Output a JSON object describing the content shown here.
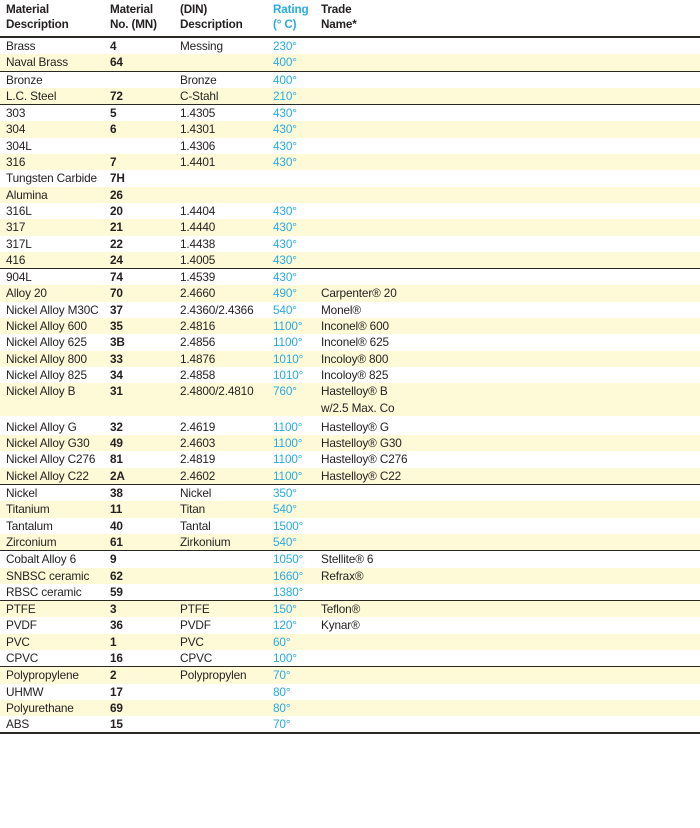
{
  "table": {
    "columns": [
      {
        "key": "description",
        "label": "Material\nDescription",
        "accent": false
      },
      {
        "key": "mn",
        "label": "Material\nNo. (MN)",
        "accent": false
      },
      {
        "key": "din",
        "label": "(DIN)\nDescription",
        "accent": false
      },
      {
        "key": "rating",
        "label": "Rating\n(° C)",
        "accent": true
      },
      {
        "key": "trade",
        "label": "Trade\nName*",
        "accent": false
      }
    ],
    "accent_color": "#29abe2",
    "band_color": "#fefad8",
    "text_color": "#231f20",
    "groups": [
      {
        "name": "copper-alloys",
        "rows": [
          {
            "description": "Brass",
            "mn": "4",
            "din": "Messing",
            "rating": "230°",
            "trade": ""
          },
          {
            "description": "Naval Brass",
            "mn": "64",
            "din": "",
            "rating": "400°",
            "trade": ""
          }
        ]
      },
      {
        "name": "bronze-and-carbon-steel",
        "rows": [
          {
            "description": "Bronze",
            "mn": "",
            "din": "Bronze",
            "rating": "400°",
            "trade": ""
          },
          {
            "description": "L.C. Steel",
            "mn": "72",
            "din": "C-Stahl",
            "rating": "210°",
            "trade": ""
          }
        ]
      },
      {
        "name": "stainless-steels-and-hard-materials",
        "rows": [
          {
            "description": "303",
            "mn": "5",
            "din": "1.4305",
            "rating": "430°",
            "trade": ""
          },
          {
            "description": "304",
            "mn": "6",
            "din": "1.4301",
            "rating": "430°",
            "trade": ""
          },
          {
            "description": "304L",
            "mn": "",
            "din": "1.4306",
            "rating": "430°",
            "trade": ""
          },
          {
            "description": "316",
            "mn": "7",
            "din": "1.4401",
            "rating": "430°",
            "trade": ""
          },
          {
            "description": "Tungsten Carbide",
            "mn": "7H",
            "din": "",
            "rating": "",
            "trade": ""
          },
          {
            "description": "Alumina",
            "mn": "26",
            "din": "",
            "rating": "",
            "trade": ""
          },
          {
            "description": "316L",
            "mn": "20",
            "din": "1.4404",
            "rating": "430°",
            "trade": ""
          },
          {
            "description": "317",
            "mn": "21",
            "din": "1.4440",
            "rating": "430°",
            "trade": ""
          },
          {
            "description": "317L",
            "mn": "22",
            "din": "1.4438",
            "rating": "430°",
            "trade": ""
          },
          {
            "description": "416",
            "mn": "24",
            "din": "1.4005",
            "rating": "430°",
            "trade": ""
          }
        ]
      },
      {
        "name": "high-alloys-and-nickel-alloys",
        "rows": [
          {
            "description": "904L",
            "mn": "74",
            "din": "1.4539",
            "rating": "430°",
            "trade": ""
          },
          {
            "description": "Alloy 20",
            "mn": "70",
            "din": "2.4660",
            "rating": "490°",
            "trade": "Carpenter® 20"
          },
          {
            "description": "Nickel Alloy M30C",
            "mn": "37",
            "din": "2.4360/2.4366",
            "rating": "540°",
            "trade": "Monel®"
          },
          {
            "description": "Nickel Alloy 600",
            "mn": "35",
            "din": "2.4816",
            "rating": "1100°",
            "trade": "Inconel® 600"
          },
          {
            "description": "Nickel Alloy 625",
            "mn": "3B",
            "din": "2.4856",
            "rating": "1100°",
            "trade": "Inconel® 625"
          },
          {
            "description": "Nickel Alloy 800",
            "mn": "33",
            "din": "1.4876",
            "rating": "1010°",
            "trade": "Incoloy® 800"
          },
          {
            "description": "Nickel Alloy 825",
            "mn": "34",
            "din": "2.4858",
            "rating": "1010°",
            "trade": "Incoloy® 825"
          },
          {
            "description": "Nickel Alloy B",
            "mn": "31",
            "din": "2.4800/2.4810",
            "rating": "760°",
            "trade": "Hastelloy® B\nw/2.5   Max. Co",
            "tall": true
          },
          {
            "description": "Nickel Alloy G",
            "mn": "32",
            "din": "2.4619",
            "rating": "1100°",
            "trade": "Hastelloy® G"
          },
          {
            "description": "Nickel Alloy G30",
            "mn": "49",
            "din": "2.4603",
            "rating": "1100°",
            "trade": "Hastelloy® G30"
          },
          {
            "description": "Nickel Alloy C276",
            "mn": "81",
            "din": "2.4819",
            "rating": "1100°",
            "trade": "Hastelloy® C276"
          },
          {
            "description": "Nickel Alloy C22",
            "mn": "2A",
            "din": "2.4602",
            "rating": "1100°",
            "trade": "Hastelloy® C22"
          }
        ]
      },
      {
        "name": "reactive-and-refractory-metals",
        "rows": [
          {
            "description": "Nickel",
            "mn": "38",
            "din": "Nickel",
            "rating": "350°",
            "trade": ""
          },
          {
            "description": "Titanium",
            "mn": "11",
            "din": "Titan",
            "rating": "540°",
            "trade": ""
          },
          {
            "description": "Tantalum",
            "mn": "40",
            "din": "Tantal",
            "rating": "1500°",
            "trade": ""
          },
          {
            "description": "Zirconium",
            "mn": "61",
            "din": "Zirkonium",
            "rating": "540°",
            "trade": ""
          }
        ]
      },
      {
        "name": "hardfacing-and-ceramics",
        "rows": [
          {
            "description": "Cobalt Alloy 6",
            "mn": "9",
            "din": "",
            "rating": "1050°",
            "trade": "Stellite® 6"
          },
          {
            "description": "SNBSC ceramic",
            "mn": "62",
            "din": "",
            "rating": "1660°",
            "trade": "Refrax®"
          },
          {
            "description": "RBSC ceramic",
            "mn": "59",
            "din": "",
            "rating": "1380°",
            "trade": ""
          }
        ]
      },
      {
        "name": "fluoropolymers-and-vinyls",
        "rows": [
          {
            "description": "PTFE",
            "mn": "3",
            "din": "PTFE",
            "rating": "150°",
            "trade": "Teflon®"
          },
          {
            "description": "PVDF",
            "mn": "36",
            "din": "PVDF",
            "rating": "120°",
            "trade": "Kynar®"
          },
          {
            "description": "PVC",
            "mn": "1",
            "din": "PVC",
            "rating": "60°",
            "trade": ""
          },
          {
            "description": "CPVC",
            "mn": "16",
            "din": "CPVC",
            "rating": "100°",
            "trade": ""
          }
        ]
      },
      {
        "name": "polyolefins-and-engineering-plastics",
        "rows": [
          {
            "description": "Polypropylene",
            "mn": "2",
            "din": "Polypropylen",
            "rating": "70°",
            "trade": ""
          },
          {
            "description": "UHMW",
            "mn": "17",
            "din": "",
            "rating": "80°",
            "trade": ""
          },
          {
            "description": "Polyurethane",
            "mn": "69",
            "din": "",
            "rating": "80°",
            "trade": ""
          },
          {
            "description": "ABS",
            "mn": "15",
            "din": "",
            "rating": "70°",
            "trade": ""
          }
        ]
      }
    ]
  }
}
